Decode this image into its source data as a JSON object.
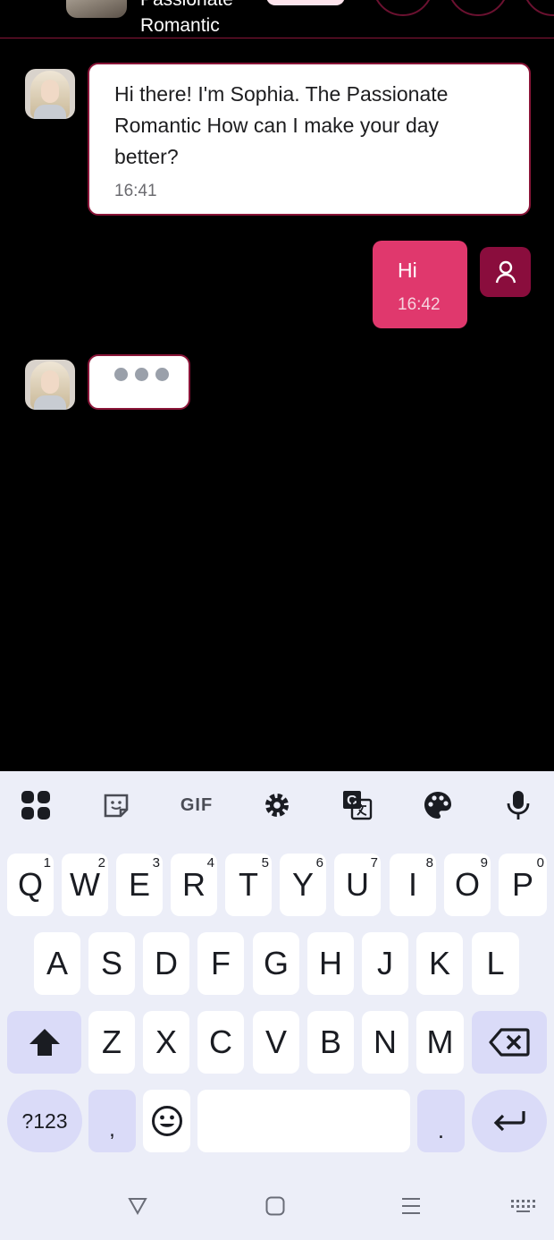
{
  "header": {
    "title_line1": "Passionate",
    "title_line2": "Romantic"
  },
  "messages": [
    {
      "sender": "bot",
      "text": "Hi there! I'm Sophia. The Passionate Romantic How can I make your day better?",
      "time": "16:41"
    },
    {
      "sender": "user",
      "text": "Hi",
      "time": "16:42"
    }
  ],
  "typing": {
    "dots": 3
  },
  "keyboard": {
    "toolbar": [
      "apps-icon",
      "sticker-icon",
      "gif-icon",
      "settings-gear-icon",
      "translate-icon",
      "palette-icon",
      "microphone-icon"
    ],
    "gif_label": "GIF",
    "row1": [
      "Q",
      "W",
      "E",
      "R",
      "T",
      "Y",
      "U",
      "I",
      "O",
      "P"
    ],
    "row1_hints": [
      "1",
      "2",
      "3",
      "4",
      "5",
      "6",
      "7",
      "8",
      "9",
      "0"
    ],
    "row2": [
      "A",
      "S",
      "D",
      "F",
      "G",
      "H",
      "J",
      "K",
      "L"
    ],
    "row3": [
      "Z",
      "X",
      "C",
      "V",
      "B",
      "N",
      "M"
    ],
    "symbols_label": "?123",
    "comma_label": ",",
    "period_label": ".",
    "colors": {
      "background": "#eceef8",
      "special_key": "#dadbf8"
    }
  },
  "colors": {
    "accent": "#e0386d",
    "border": "#8a1538",
    "user_avatar": "#8a0d3d"
  }
}
